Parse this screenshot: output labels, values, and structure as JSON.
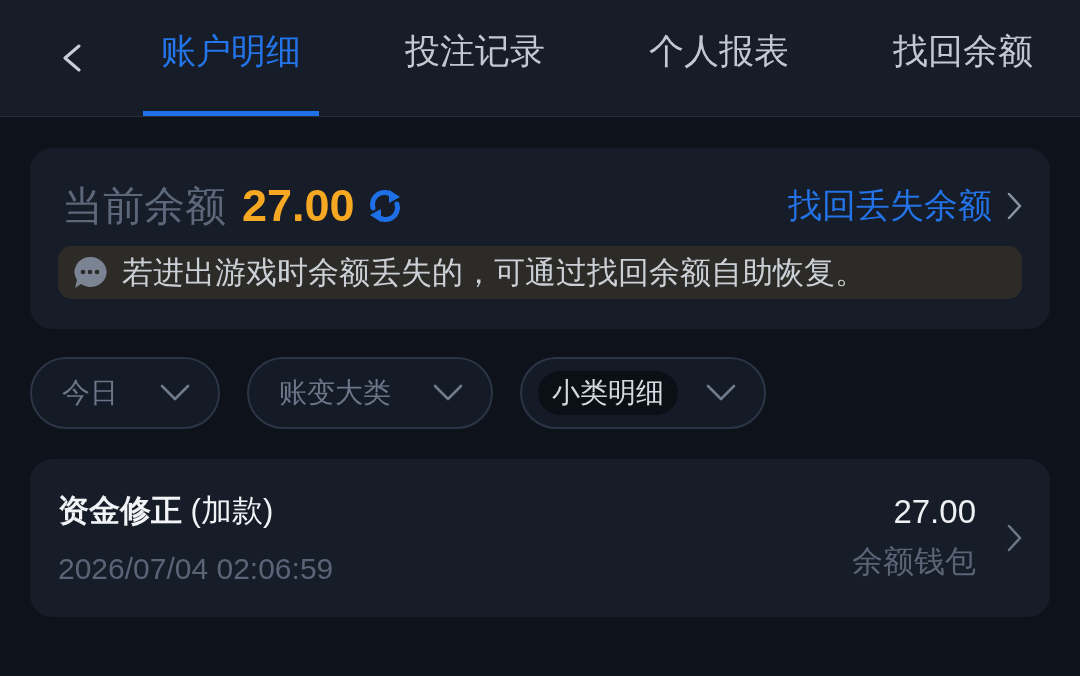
{
  "header": {
    "tabs": [
      {
        "label": "账户明细",
        "selected": true
      },
      {
        "label": "投注记录",
        "selected": false
      },
      {
        "label": "个人报表",
        "selected": false
      },
      {
        "label": "找回余额",
        "selected": false
      }
    ]
  },
  "balance": {
    "label": "当前余额",
    "amount": "27.00",
    "recover_link": "找回丢失余额",
    "notice": "若进出游戏时余额丢失的，可通过找回余额自助恢复。"
  },
  "filters": [
    {
      "label": "今日",
      "selected": false
    },
    {
      "label": "账变大类",
      "selected": false
    },
    {
      "label": "小类明细",
      "selected": true
    }
  ],
  "records": [
    {
      "title": "**资金修正** (加款)",
      "time": "2026/07/04 02:06:59",
      "amount": "27.00",
      "wallet": "余额钱包"
    }
  ]
}
